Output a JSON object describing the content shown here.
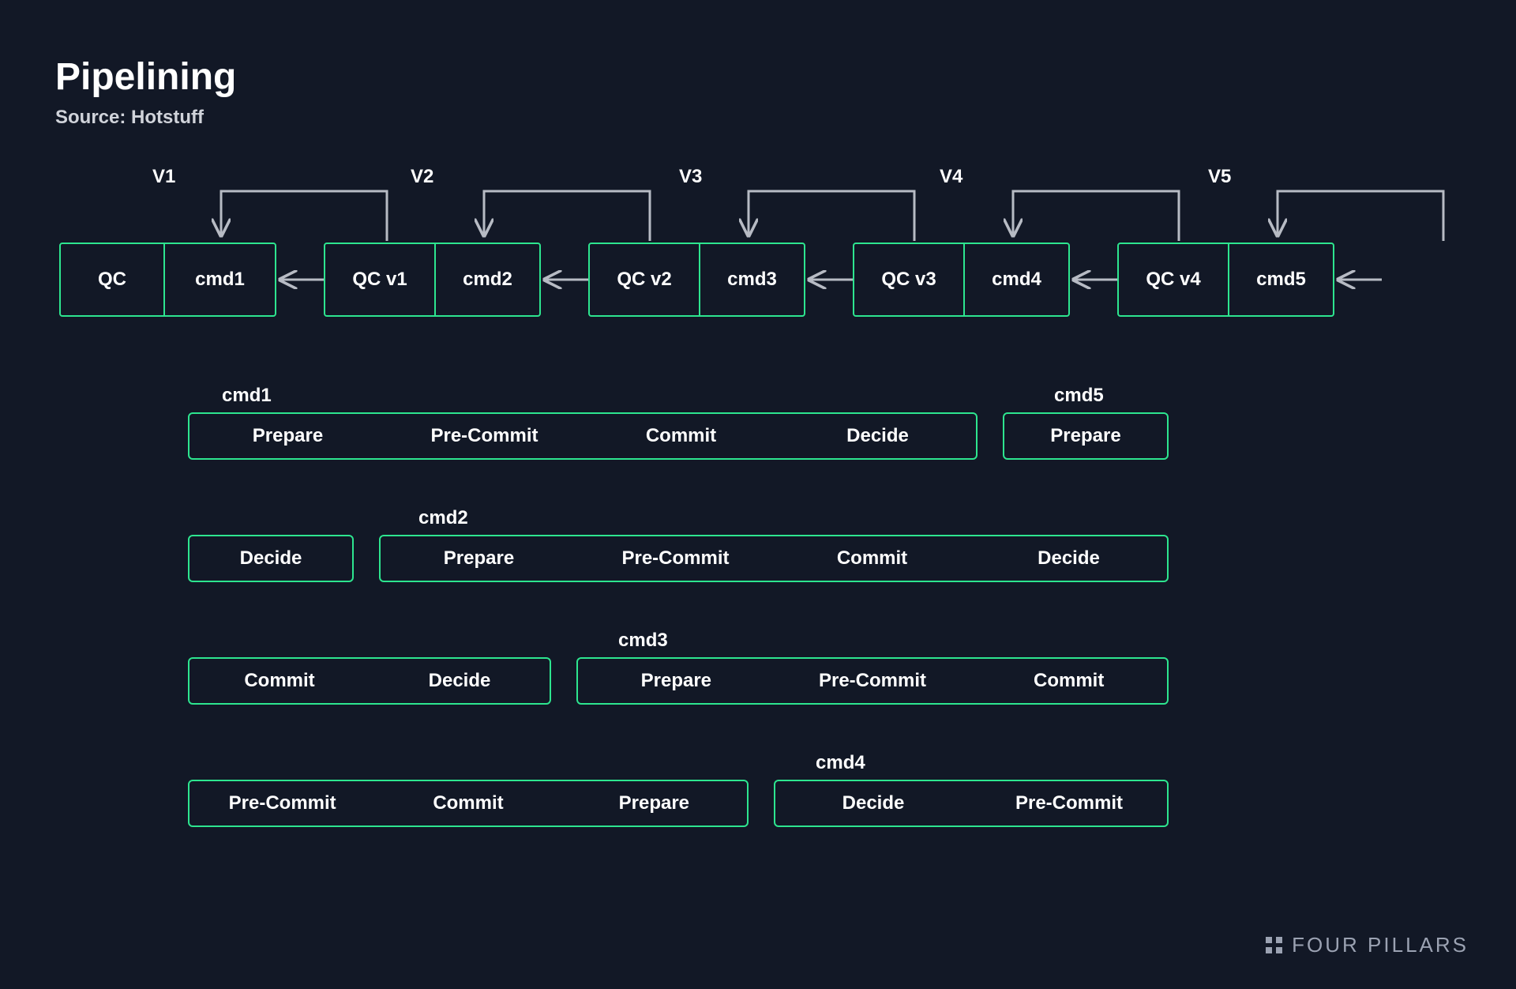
{
  "title": "Pipelining",
  "source": "Source: Hotstuff",
  "versions": [
    "V1",
    "V2",
    "V3",
    "V4",
    "V5"
  ],
  "nodes": [
    {
      "qc": "QC",
      "cmd": "cmd1"
    },
    {
      "qc": "QC v1",
      "cmd": "cmd2"
    },
    {
      "qc": "QC v2",
      "cmd": "cmd3"
    },
    {
      "qc": "QC v3",
      "cmd": "cmd4"
    },
    {
      "qc": "QC v4",
      "cmd": "cmd5"
    }
  ],
  "phase_rows": [
    {
      "boxes": [
        {
          "label": "cmd1",
          "cells": [
            "Prepare",
            "Pre-Commit",
            "Commit",
            "Decide"
          ]
        },
        {
          "label": "cmd5",
          "cells": [
            "Prepare"
          ]
        }
      ]
    },
    {
      "boxes": [
        {
          "label": null,
          "cells": [
            "Decide"
          ]
        },
        {
          "label": "cmd2",
          "cells": [
            "Prepare",
            "Pre-Commit",
            "Commit",
            "Decide"
          ]
        }
      ]
    },
    {
      "boxes": [
        {
          "label": null,
          "cells": [
            "Commit",
            "Decide"
          ]
        },
        {
          "label": "cmd3",
          "cells": [
            "Prepare",
            "Pre-Commit",
            "Commit"
          ]
        }
      ]
    },
    {
      "boxes": [
        {
          "label": null,
          "cells": [
            "Pre-Commit",
            "Commit",
            "Prepare"
          ]
        },
        {
          "label": "cmd4",
          "cells": [
            "Decide",
            "Pre-Commit"
          ]
        }
      ]
    }
  ],
  "brand": "FOUR PILLARS",
  "colors": {
    "bg": "#121826",
    "accent": "#2de58f",
    "text": "#ffffff",
    "muted": "#9ba2b2",
    "arrow": "#b7bbc4"
  }
}
